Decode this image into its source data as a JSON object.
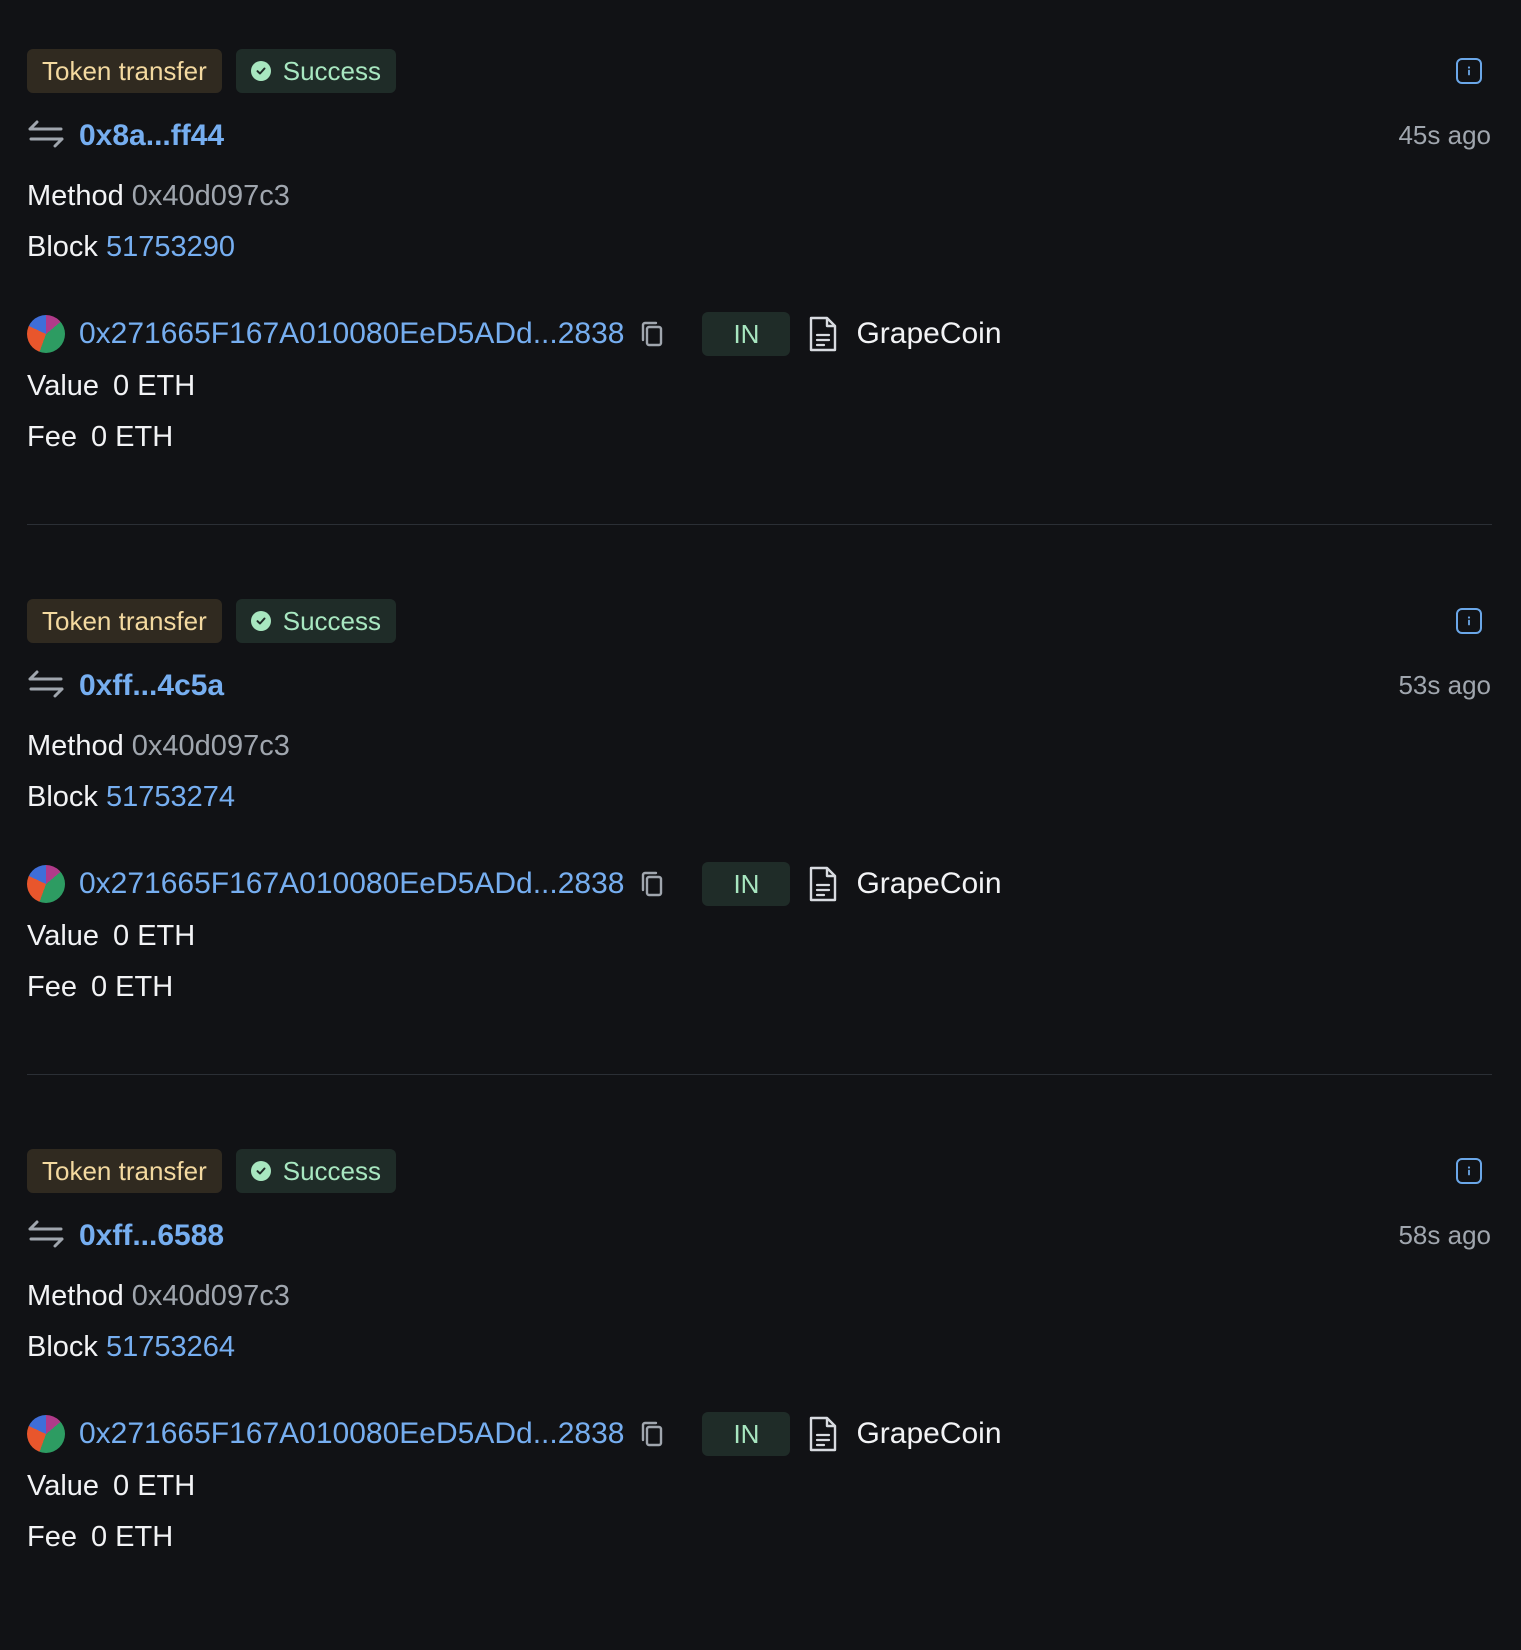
{
  "colors": {
    "background": "#111215",
    "link": "#76aef0",
    "type_tag_bg": "#302a20",
    "type_tag_text": "#f3d9a0",
    "success_bg": "#1f2c28",
    "success_text": "#a8e7c0",
    "muted_text": "#a0a6ae"
  },
  "labels": {
    "method": "Method",
    "block": "Block",
    "value": "Value",
    "fee": "Fee"
  },
  "transactions": [
    {
      "type": "Token transfer",
      "status": "Success",
      "status_icon": "check-circle-icon",
      "hash": "0x8a...ff44",
      "time": "45s ago",
      "method": "0x40d097c3",
      "block": "51753290",
      "address": "0x271665F167A010080EeD5ADd...2838",
      "direction": "IN",
      "token": "GrapeCoin",
      "value": "0 ETH",
      "fee": "0 ETH"
    },
    {
      "type": "Token transfer",
      "status": "Success",
      "status_icon": "check-circle-icon",
      "hash": "0xff...4c5a",
      "time": "53s ago",
      "method": "0x40d097c3",
      "block": "51753274",
      "address": "0x271665F167A010080EeD5ADd...2838",
      "direction": "IN",
      "token": "GrapeCoin",
      "value": "0 ETH",
      "fee": "0 ETH"
    },
    {
      "type": "Token transfer",
      "status": "Success",
      "status_icon": "check-circle-icon",
      "hash": "0xff...6588",
      "time": "58s ago",
      "method": "0x40d097c3",
      "block": "51753264",
      "address": "0x271665F167A010080EeD5ADd...2838",
      "direction": "IN",
      "token": "GrapeCoin",
      "value": "0 ETH",
      "fee": "0 ETH"
    }
  ]
}
